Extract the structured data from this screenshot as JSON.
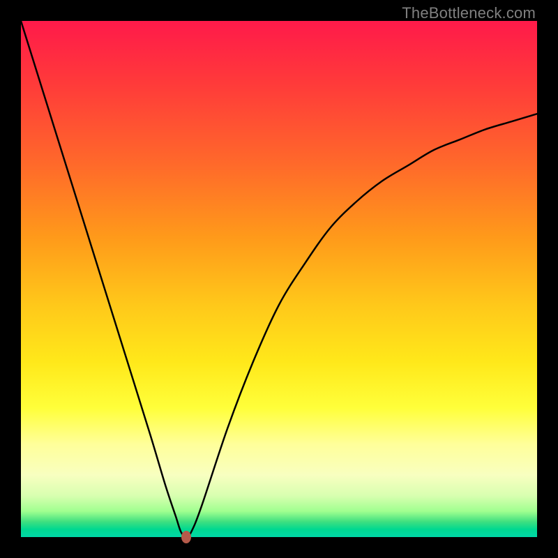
{
  "watermark": "TheBottleneck.com",
  "chart_data": {
    "type": "line",
    "title": "",
    "xlabel": "",
    "ylabel": "",
    "xlim": [
      0,
      100
    ],
    "ylim": [
      0,
      100
    ],
    "series": [
      {
        "name": "bottleneck-curve",
        "x": [
          0,
          5,
          10,
          15,
          20,
          25,
          28,
          30,
          31,
          32,
          33,
          35,
          40,
          45,
          50,
          55,
          60,
          65,
          70,
          75,
          80,
          85,
          90,
          95,
          100
        ],
        "y": [
          100,
          84,
          68,
          52,
          36,
          20,
          10,
          4,
          1,
          0,
          1,
          6,
          21,
          34,
          45,
          53,
          60,
          65,
          69,
          72,
          75,
          77,
          79,
          80.5,
          82
        ]
      }
    ],
    "marker": {
      "x": 32,
      "y": 0
    },
    "gradient_stops": [
      {
        "pos": 0,
        "color": "#ff1a4a"
      },
      {
        "pos": 50,
        "color": "#ffc81a"
      },
      {
        "pos": 80,
        "color": "#ffff9a"
      },
      {
        "pos": 100,
        "color": "#00d8a8"
      }
    ]
  }
}
